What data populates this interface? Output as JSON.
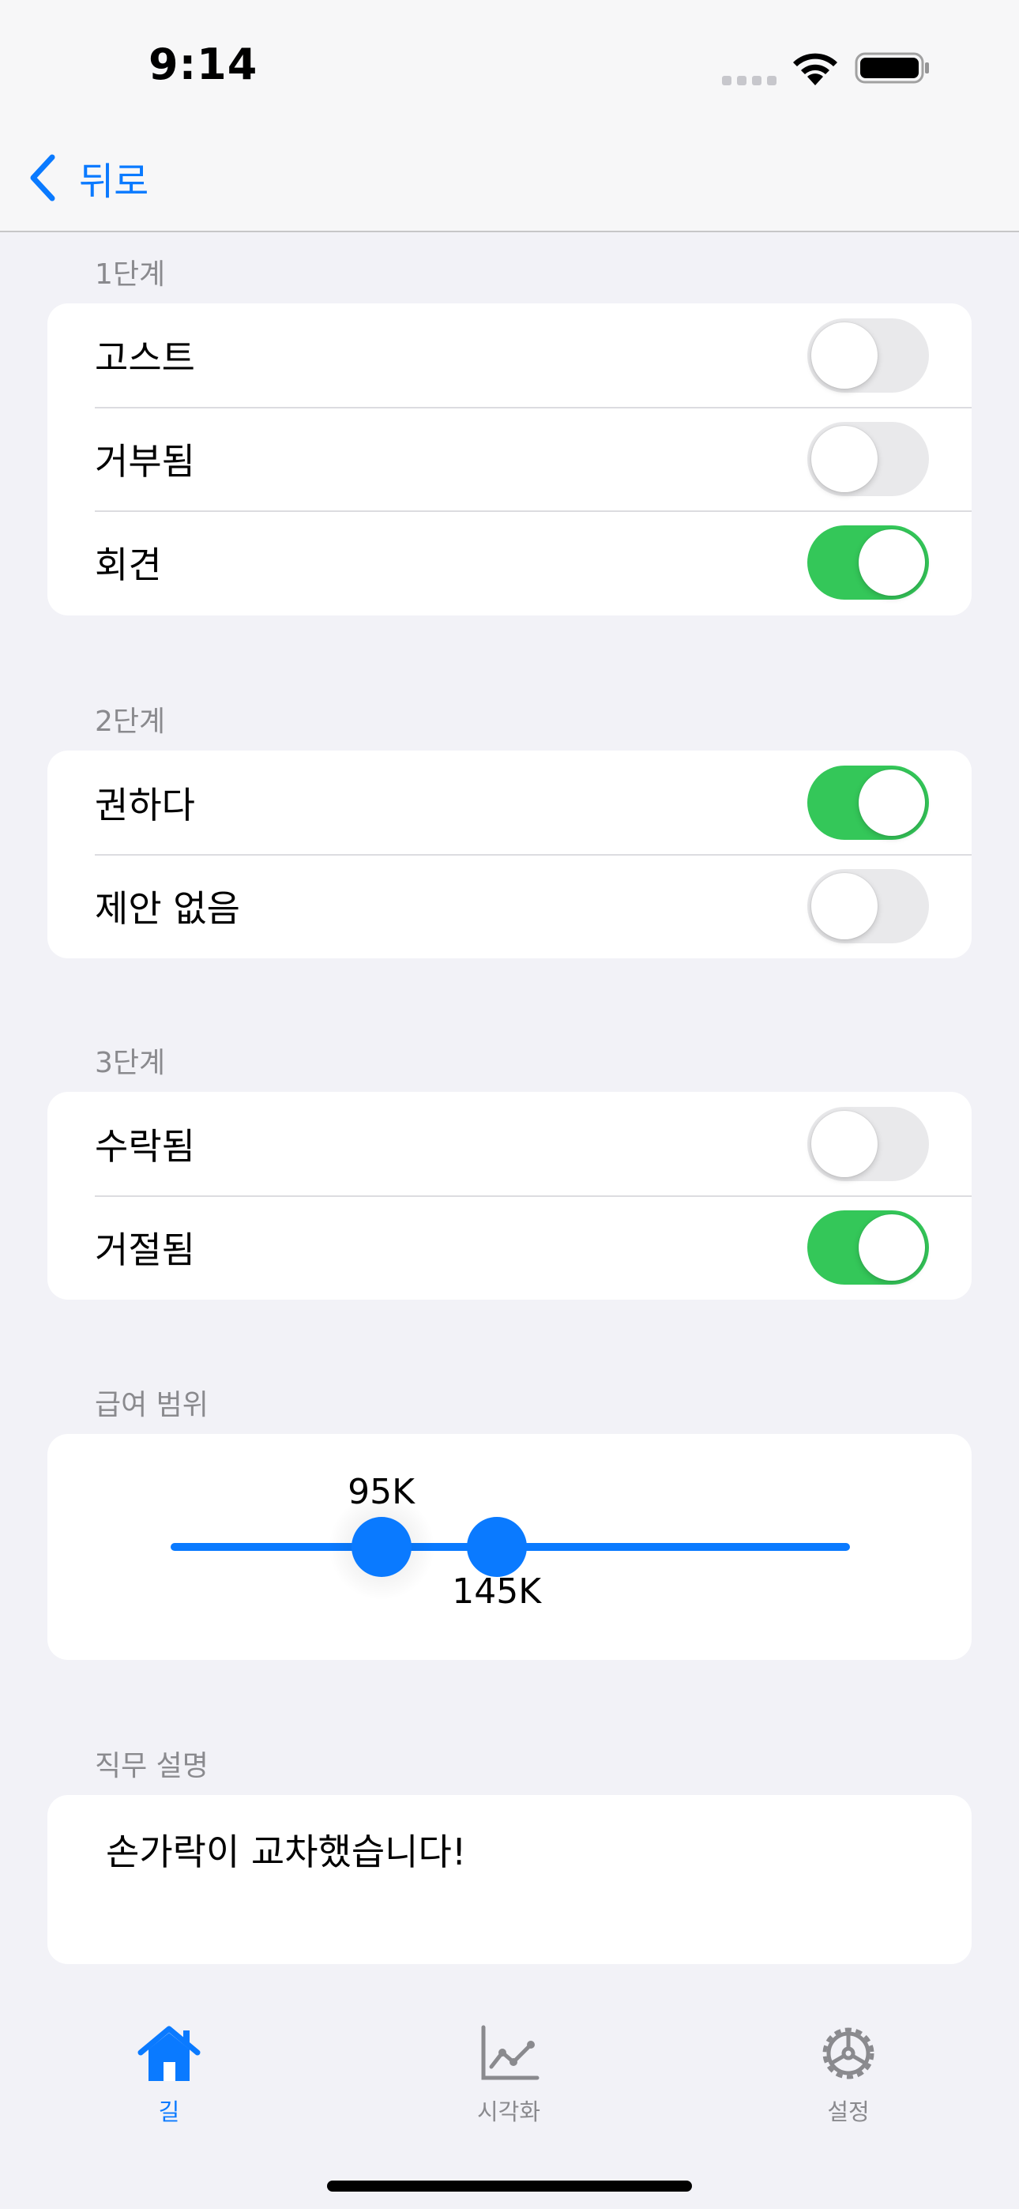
{
  "status_bar": {
    "time": "9:14"
  },
  "nav": {
    "back_label": "뒤로"
  },
  "sections": {
    "stage1": {
      "header": "1단계",
      "rows": [
        {
          "label": "고스트",
          "on": false
        },
        {
          "label": "거부됨",
          "on": false
        },
        {
          "label": "회견",
          "on": true
        }
      ]
    },
    "stage2": {
      "header": "2단계",
      "rows": [
        {
          "label": "권하다",
          "on": true
        },
        {
          "label": "제안 없음",
          "on": false
        }
      ]
    },
    "stage3": {
      "header": "3단계",
      "rows": [
        {
          "label": "수락됨",
          "on": false
        },
        {
          "label": "거절됨",
          "on": true
        }
      ]
    }
  },
  "salary": {
    "header": "급여 범위",
    "low_label": "95K",
    "high_label": "145K",
    "low_fraction": 0.31,
    "high_fraction": 0.48
  },
  "description": {
    "header": "직무 설명",
    "text": "손가락이 교차했습니다!"
  },
  "tab_bar": {
    "tabs": [
      {
        "label": "길",
        "icon": "house-icon",
        "active": true
      },
      {
        "label": "시각화",
        "icon": "chart-icon",
        "active": false
      },
      {
        "label": "설정",
        "icon": "gear-icon",
        "active": false
      }
    ]
  },
  "colors": {
    "accent": "#0a7aff",
    "toggle_on": "#34c759",
    "toggle_off": "#e9e9eb",
    "background": "#f2f2f7"
  }
}
